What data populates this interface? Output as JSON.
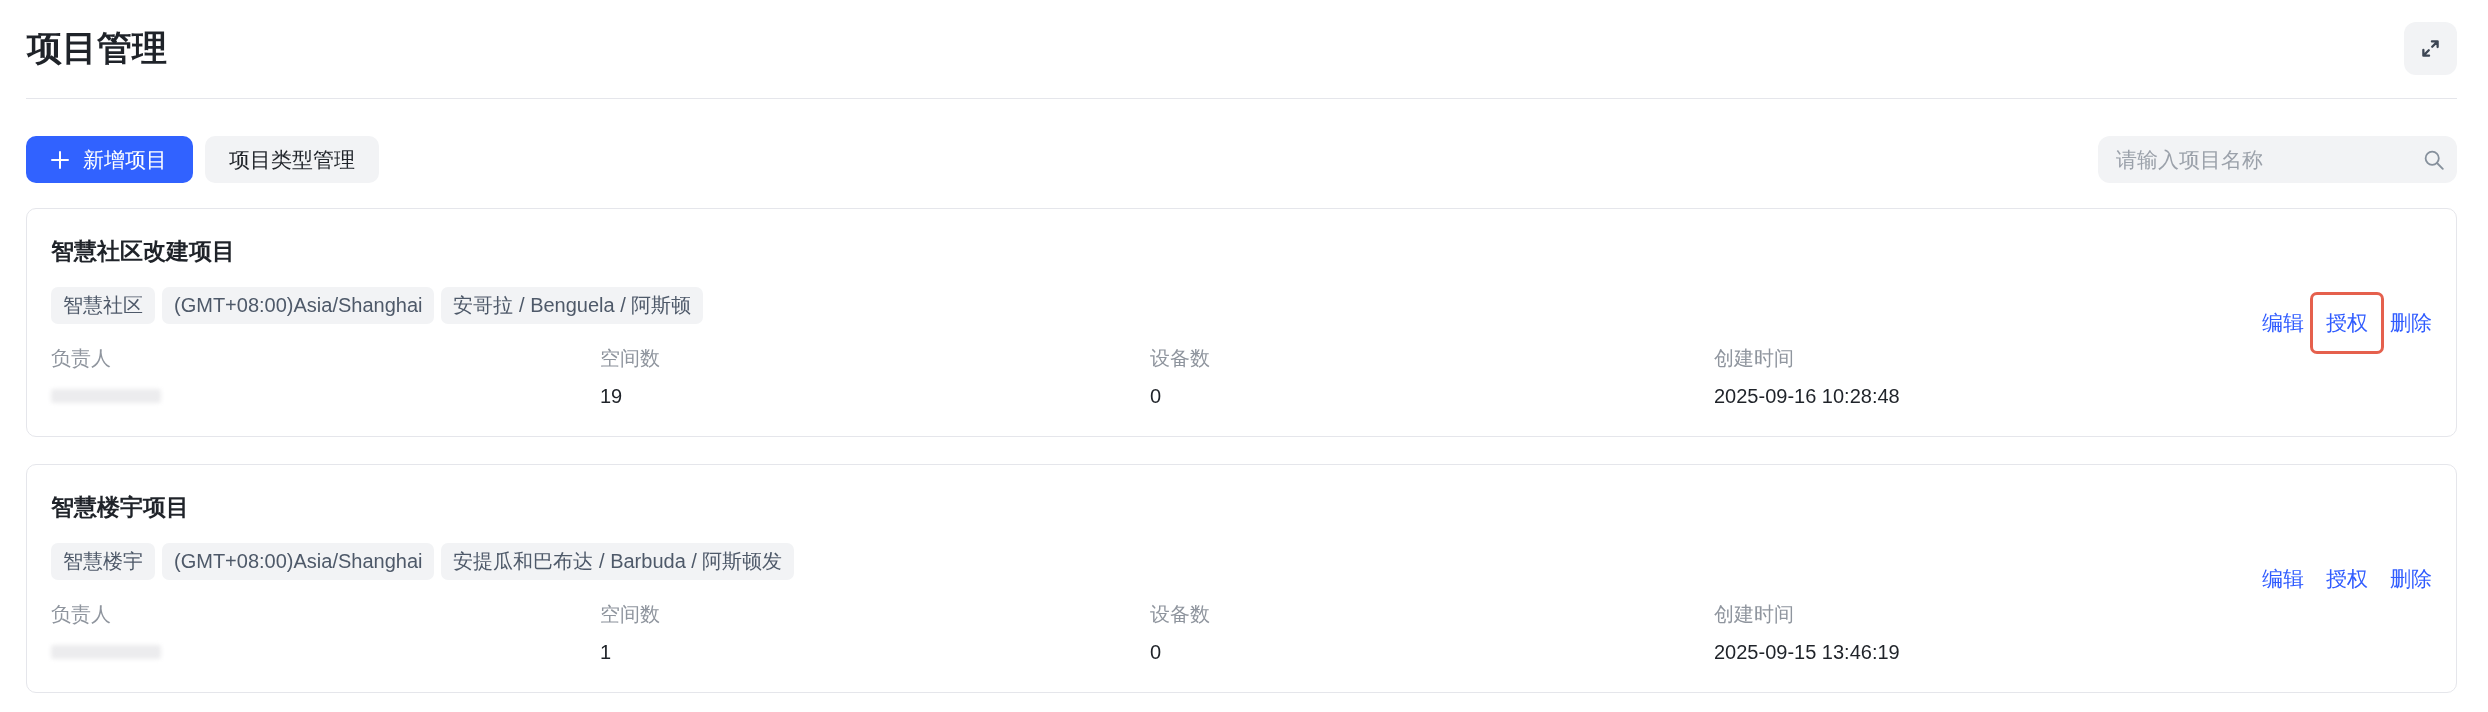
{
  "page": {
    "title": "项目管理"
  },
  "toolbar": {
    "buttons": [
      {
        "label": "新增项目",
        "kind": "primary"
      },
      {
        "label": "项目类型管理",
        "kind": "secondary"
      }
    ],
    "search": {
      "placeholder": "请输入项目名称"
    }
  },
  "projects": [
    {
      "name": "智慧社区改建项目",
      "tags": [
        "智慧社区",
        "(GMT+08:00)Asia/Shanghai",
        "安哥拉 / Benguela / 阿斯顿"
      ],
      "fields": [
        {
          "label": "负责人",
          "redacted": true
        },
        {
          "label": "空间数",
          "value": "19",
          "redacted": false
        },
        {
          "label": "设备数",
          "value": "0",
          "redacted": false
        },
        {
          "label": "创建时间",
          "value": "2025-09-16 10:28:48",
          "redacted": false
        }
      ],
      "actions": [
        {
          "label": "编辑",
          "highlighted": false
        },
        {
          "label": "授权",
          "highlighted": true
        },
        {
          "label": "删除",
          "highlighted": false
        }
      ]
    },
    {
      "name": "智慧楼宇项目",
      "tags": [
        "智慧楼宇",
        "(GMT+08:00)Asia/Shanghai",
        "安提瓜和巴布达 / Barbuda / 阿斯顿发"
      ],
      "fields": [
        {
          "label": "负责人",
          "redacted": true
        },
        {
          "label": "空间数",
          "value": "1",
          "redacted": false
        },
        {
          "label": "设备数",
          "value": "0",
          "redacted": false
        },
        {
          "label": "创建时间",
          "value": "2025-09-15 13:46:19",
          "redacted": false
        }
      ],
      "actions": [
        {
          "label": "编辑",
          "highlighted": false
        },
        {
          "label": "授权",
          "highlighted": false
        },
        {
          "label": "删除",
          "highlighted": false
        }
      ]
    }
  ]
}
